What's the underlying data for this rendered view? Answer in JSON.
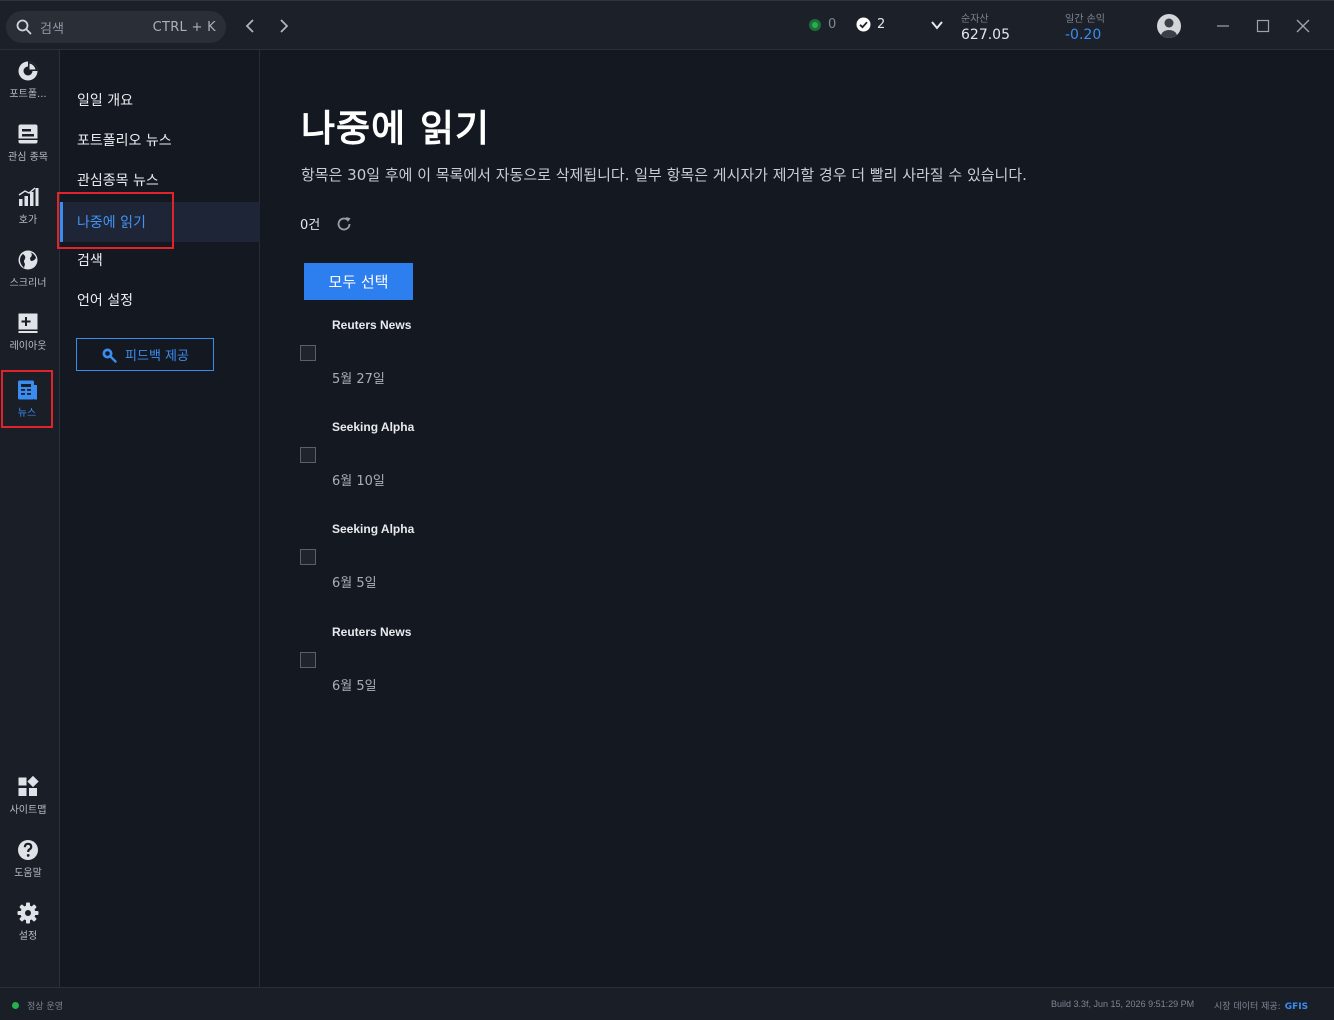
{
  "search": {
    "placeholder": "검색",
    "shortcut": "CTRL + K"
  },
  "status": {
    "alerts_count": "0",
    "done_count": "2"
  },
  "stats": {
    "net_assets_label": "순자산",
    "net_assets_value": "627.05",
    "daily_pl_label": "일간 손익",
    "daily_pl_value": "-0.20"
  },
  "rail": [
    {
      "label": "포트폴...",
      "icon": "portfolio-icon"
    },
    {
      "label": "관심 종목",
      "icon": "watchlist-icon"
    },
    {
      "label": "호가",
      "icon": "quotes-icon"
    },
    {
      "label": "스크리너",
      "icon": "globe-icon"
    },
    {
      "label": "레이아웃",
      "icon": "layout-icon"
    },
    {
      "label": "뉴스",
      "icon": "news-icon"
    },
    {
      "label": "사이트맵",
      "icon": "sitemap-icon"
    },
    {
      "label": "도움말",
      "icon": "help-icon"
    },
    {
      "label": "설정",
      "icon": "gear-icon"
    }
  ],
  "subnav": {
    "items": [
      "일일 개요",
      "포트폴리오 뉴스",
      "관심종목 뉴스",
      "나중에 읽기",
      "검색",
      "언어 설정"
    ],
    "feedback_label": "피드백 제공"
  },
  "main": {
    "title": "나중에 읽기",
    "description": "항목은 30일 후에 이 목록에서 자동으로 삭제됩니다. 일부 항목은 게시자가 제거할 경우 더 빨리 사라질 수 있습니다.",
    "count": "0건",
    "select_all_label": "모두 선택",
    "items": [
      {
        "source": "Reuters News",
        "date": "5월 27일"
      },
      {
        "source": "Seeking Alpha",
        "date": "6월 10일"
      },
      {
        "source": "Seeking Alpha",
        "date": "6월 5일"
      },
      {
        "source": "Reuters News",
        "date": "6월 5일"
      }
    ]
  },
  "statusbar": {
    "status_text": "정상 운영",
    "build_text": "Build 3.3f, Jun 15, 2026 9:51:29 PM",
    "provider_label": "시장 데이터 제공:",
    "provider_name": "GFIS"
  },
  "colors": {
    "accent": "#3b8cf0",
    "highlight": "#e0242b",
    "ok": "#23b14d"
  }
}
